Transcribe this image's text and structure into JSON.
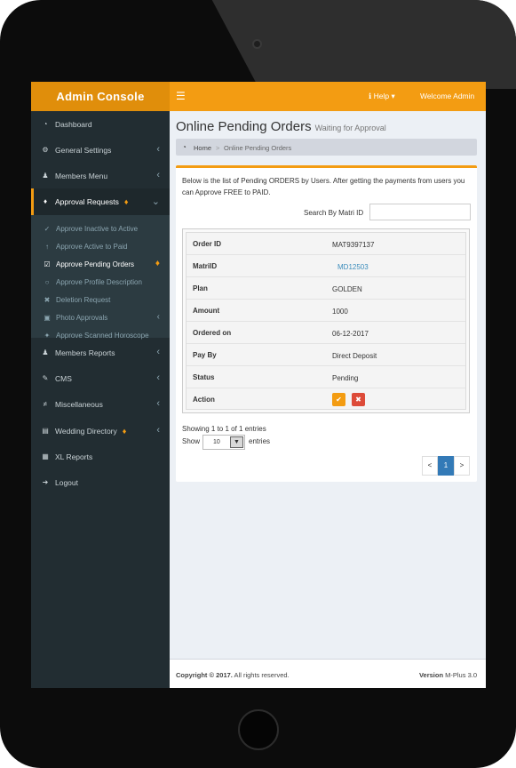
{
  "header": {
    "logo": "Admin Console",
    "menu_icon": "bars-icon",
    "help": "Help",
    "welcome": "Welcome Admin"
  },
  "sidebar": {
    "items": [
      {
        "label": "Dashboard",
        "icon": "dashboard-icon"
      },
      {
        "label": "General Settings",
        "icon": "cogs-icon"
      },
      {
        "label": "Members Menu",
        "icon": "users-icon"
      },
      {
        "label": "Approval Requests",
        "icon": "bell-icon"
      },
      {
        "label": "Members Reports",
        "icon": "users-icon"
      },
      {
        "label": "CMS",
        "icon": "edit-icon"
      },
      {
        "label": "Miscellaneous",
        "icon": "sliders-icon"
      },
      {
        "label": "Wedding Directory",
        "icon": "book-icon"
      },
      {
        "label": "XL Reports",
        "icon": "file-excel-icon"
      },
      {
        "label": "Logout",
        "icon": "sign-out-icon"
      }
    ],
    "submenu": [
      {
        "label": "Approve Inactive to Active",
        "icon": "check-icon"
      },
      {
        "label": "Approve Active to Paid",
        "icon": "level-up-icon"
      },
      {
        "label": "Approve Pending Orders",
        "icon": "check-square-icon"
      },
      {
        "label": "Approve Profile Description",
        "icon": "comment-icon"
      },
      {
        "label": "Deletion Request",
        "icon": "times-icon"
      },
      {
        "label": "Photo Approvals",
        "icon": "image-icon"
      },
      {
        "label": "Approve Scanned Horoscope",
        "icon": "magic-icon"
      }
    ]
  },
  "page": {
    "title": "Online Pending Orders",
    "subtitle": "Waiting for Approval",
    "breadcrumb_home": "Home",
    "breadcrumb_sep": ">",
    "breadcrumb_current": "Online Pending Orders"
  },
  "box": {
    "intro": "Below is the list of Pending ORDERS by Users. After getting the payments from users you can Approve FREE to PAID.",
    "search_label": "Search By Matri ID",
    "search_value": "",
    "rows": [
      {
        "key": "Order ID",
        "value": "MAT9397137"
      },
      {
        "key": "MatriID",
        "value": "MD12503"
      },
      {
        "key": "Plan",
        "value": "GOLDEN"
      },
      {
        "key": "Amount",
        "value": "1000"
      },
      {
        "key": "Ordered on",
        "value": "06-12-2017"
      },
      {
        "key": "Pay By",
        "value": "Direct Deposit"
      },
      {
        "key": "Status",
        "value": "Pending"
      },
      {
        "key": "Action",
        "value": ""
      }
    ],
    "showing": "Showing 1 to 1 of 1 entries",
    "show_label": "Show",
    "show_value": "10",
    "entries_label": "entries",
    "pagination": {
      "prev": "<",
      "current": "1",
      "next": ">"
    }
  },
  "footer": {
    "copyright_bold": "Copyright © 2017.",
    "copyright_rest": " All rights reserved.",
    "version_bold": "Version",
    "version_value": " M-Plus 3.0"
  },
  "colors": {
    "accent": "#f39c12",
    "sidebar": "#222d32",
    "link": "#3c8dbc",
    "danger": "#dd4b39"
  }
}
